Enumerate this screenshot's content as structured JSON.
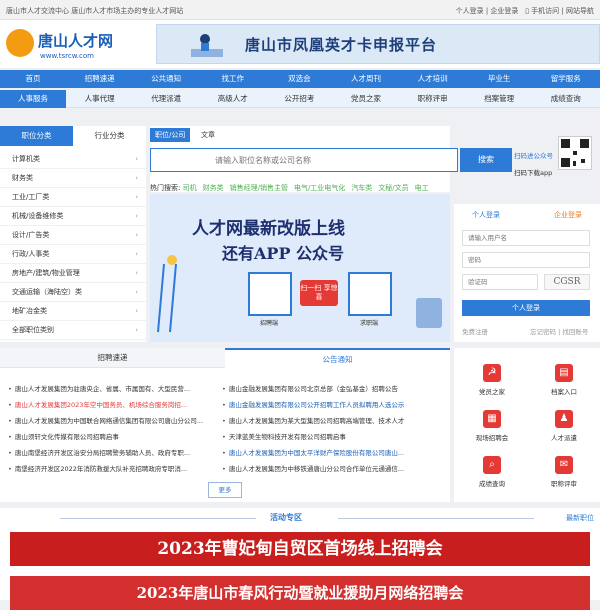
{
  "topbar": {
    "left_text": "唐山市人才交流中心   唐山市人才市场主办的专业人才网站",
    "right_links": [
      "个人登录",
      "企业登录",
      "手机访问",
      "网站导航"
    ]
  },
  "header": {
    "logo_text": "唐山人才网",
    "logo_url": "www.tsrcw.com",
    "banner_text": "唐山市凤凰英才卡申报平台"
  },
  "nav_main": [
    "首页",
    "招聘速递",
    "公共通知",
    "找工作",
    "双选会",
    "人才周刊",
    "人才培训",
    "毕业生",
    "留学服务"
  ],
  "nav_sub": [
    "人事服务",
    "人事代理",
    "代理派遣",
    "高级人才",
    "公开招考",
    "党员之家",
    "职称评审",
    "档案管理",
    "成绩查询"
  ],
  "categories": {
    "tabs": [
      "职位分类",
      "行业分类"
    ],
    "items": [
      "计算机类",
      "财务类",
      "工业/工厂类",
      "机械/设备维修类",
      "设计/广告类",
      "行政/人事类",
      "房地产/建筑/物业管理",
      "交通运输（海陆空）类",
      "地矿冶金类",
      "全部职位类别"
    ]
  },
  "search": {
    "tabs": [
      "职位/公司",
      "文章"
    ],
    "placeholder": "请输入职位名称或公司名称",
    "button": "搜索",
    "hot_label": "热门搜索:",
    "hot_terms": [
      "司机",
      "财务类",
      "销售经理/销售主管",
      "电气/工业电气化",
      "汽车类",
      "文秘/文员",
      "电工"
    ]
  },
  "qr": {
    "line1": "扫码进公众号",
    "line2": "扫码下载app"
  },
  "main_banner": {
    "line1": "人才网最新改版上线",
    "line2": "还有APP 公众号",
    "btn": "扫一扫 享惊喜",
    "label1": "招聘端",
    "label2": "求职端"
  },
  "login": {
    "tab_person": "个人登录",
    "tab_company": "企业登录",
    "user_placeholder": "请输入用户名",
    "pass_placeholder": "密码",
    "captcha_placeholder": "验证码",
    "captcha_text": "CGSR",
    "button": "个人登录",
    "register": "免费注册",
    "forgot": "忘记密码 | 找回账号"
  },
  "news": {
    "tabs": [
      "招聘速递",
      "公告通知"
    ],
    "left": [
      "唐山人才发展集团为驻唐央企、省属、市属国有、大型民营...",
      "唐山人才发展集团2023年空中国务员、机场综合服务岗招...",
      "唐山人才发展集团为中国联合网络通信集团有限公司唐山分公司...",
      "唐山须轩文化传媒有限公司招聘启事",
      "唐山南堡经济开发区治安分局招聘警务辅助人员、政府专职...",
      "南堡经济开发区2022年消防救援大队补充招聘政府专职消..."
    ],
    "right": [
      "唐山金融发展集团有限公司北京总部（金弘基金）招聘公告",
      "唐山金融发展集团有限公司公开招聘工作人员拟聘用人选公示",
      "唐山人才发展集团为某大型集团公司招聘高端管理、技术人才",
      "天津蓝美生物科技开发有限公司招聘启事",
      "唐山人才发展集团为中国太平洋财产保险股份有限公司唐山...",
      "唐山人才发展集团为中移铁通唐山分公司合作单位元通通信..."
    ],
    "more": "更多"
  },
  "services": [
    "党员之家",
    "档案入口",
    "现场招聘会",
    "人才派遣",
    "成绩查询",
    "职称评审"
  ],
  "activity": {
    "title": "活动专区",
    "more": "最新职位",
    "banner1": "2023年曹妃甸自贸区首场线上招聘会",
    "banner2": "2023年唐山市春风行动暨就业援助月网络招聘会"
  }
}
